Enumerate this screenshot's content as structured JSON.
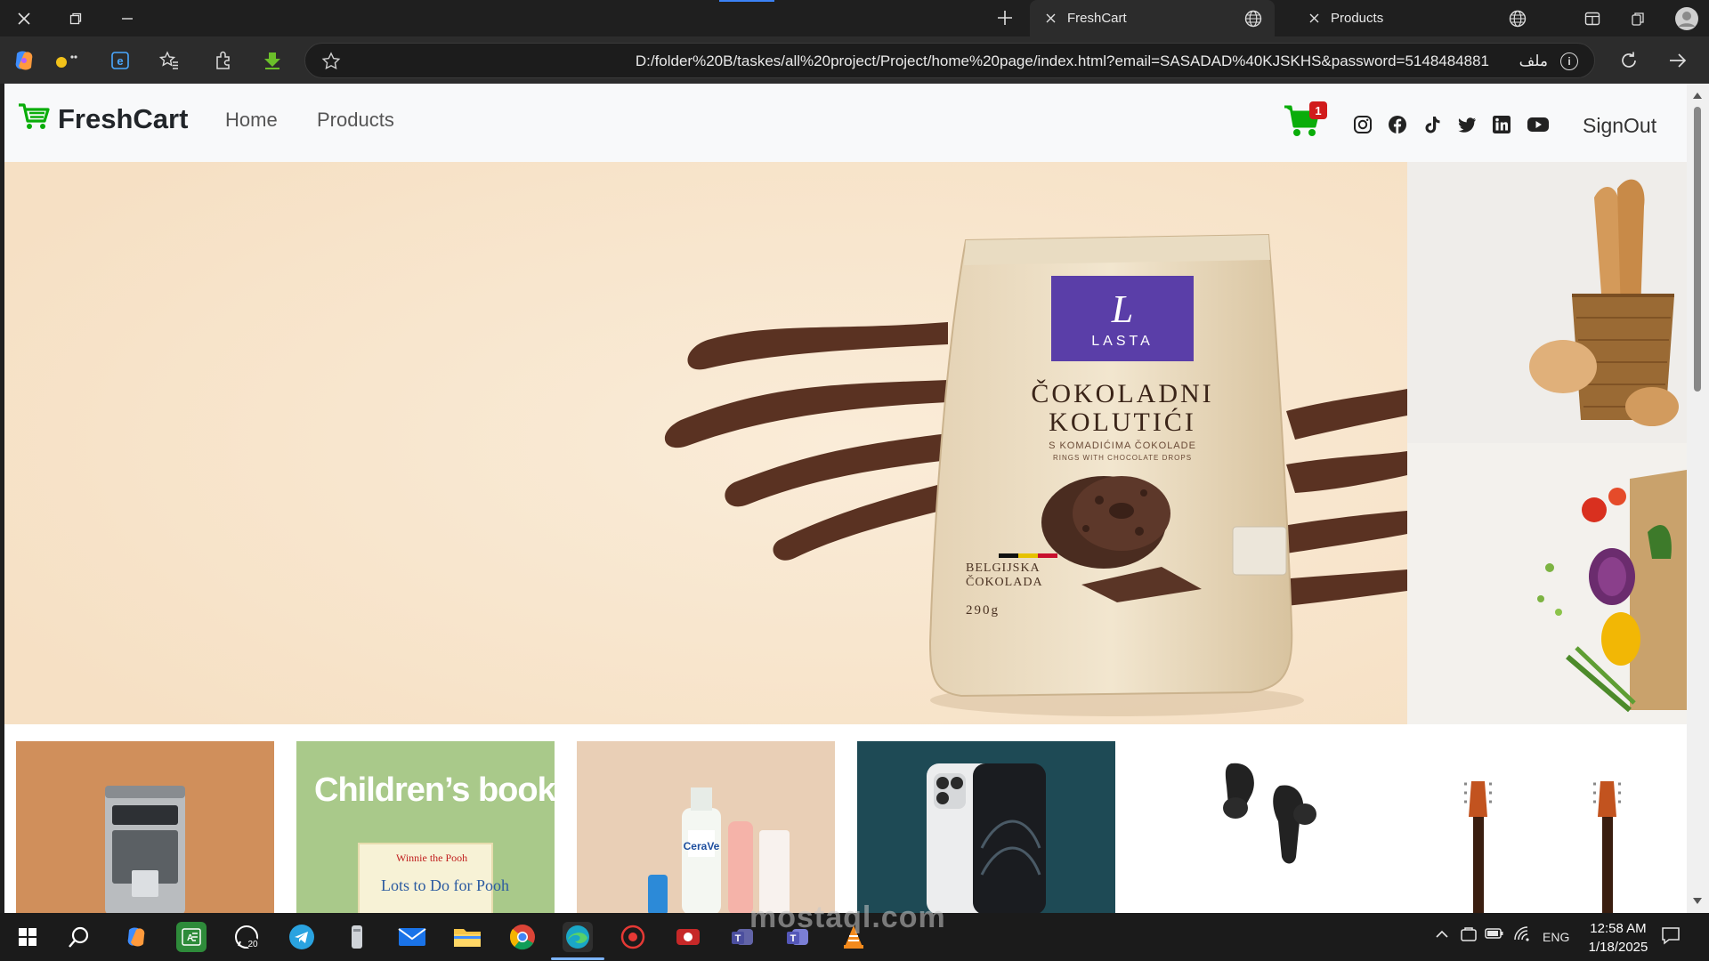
{
  "browser": {
    "tabs": [
      {
        "title": "FreshCart",
        "active": true
      },
      {
        "title": "Products",
        "active": false
      }
    ],
    "address": {
      "url": "D:/folder%20B/taskes/all%20project/Project/home%20page/index.html?email=SASADAD%40KJSKHS&password=5148484881",
      "file_label": "ملف"
    }
  },
  "site": {
    "brand": "FreshCart",
    "nav": {
      "home": "Home",
      "products": "Products"
    },
    "cart_count": "1",
    "signout": "SignOut",
    "social_icons": [
      "instagram-icon",
      "facebook-icon",
      "tiktok-icon",
      "twitter-icon",
      "linkedin-icon",
      "youtube-icon"
    ],
    "brand_color": "#0aad0a"
  },
  "hero": {
    "product_brand": "LASTA",
    "product_name_line1": "ČOKOLADNI",
    "product_name_line2": "KOLUTIĆI",
    "product_sub1": "S KOMADIĆIMA ČOKOLADE",
    "product_sub2": "RINGS WITH CHOCOLATE DROPS",
    "product_origin_line1": "BELGIJSKA",
    "product_origin_line2": "ČOKOLADA",
    "product_weight": "290g"
  },
  "categories": [
    {
      "name": "coffee-machine",
      "label": ""
    },
    {
      "name": "childrens-books",
      "label": "Children’s books",
      "book_title": "Lots to Do for Pooh",
      "book_brand": "Winnie the Pooh"
    },
    {
      "name": "skincare",
      "label": "",
      "product_text": "CeraVe"
    },
    {
      "name": "phone",
      "label": ""
    },
    {
      "name": "earbuds",
      "label": ""
    },
    {
      "name": "guitar",
      "label": ""
    }
  ],
  "taskbar": {
    "time": "12:58 AM",
    "date": "1/18/2025",
    "language": "ENG",
    "badge": "20"
  },
  "watermark": "mostaql.com"
}
